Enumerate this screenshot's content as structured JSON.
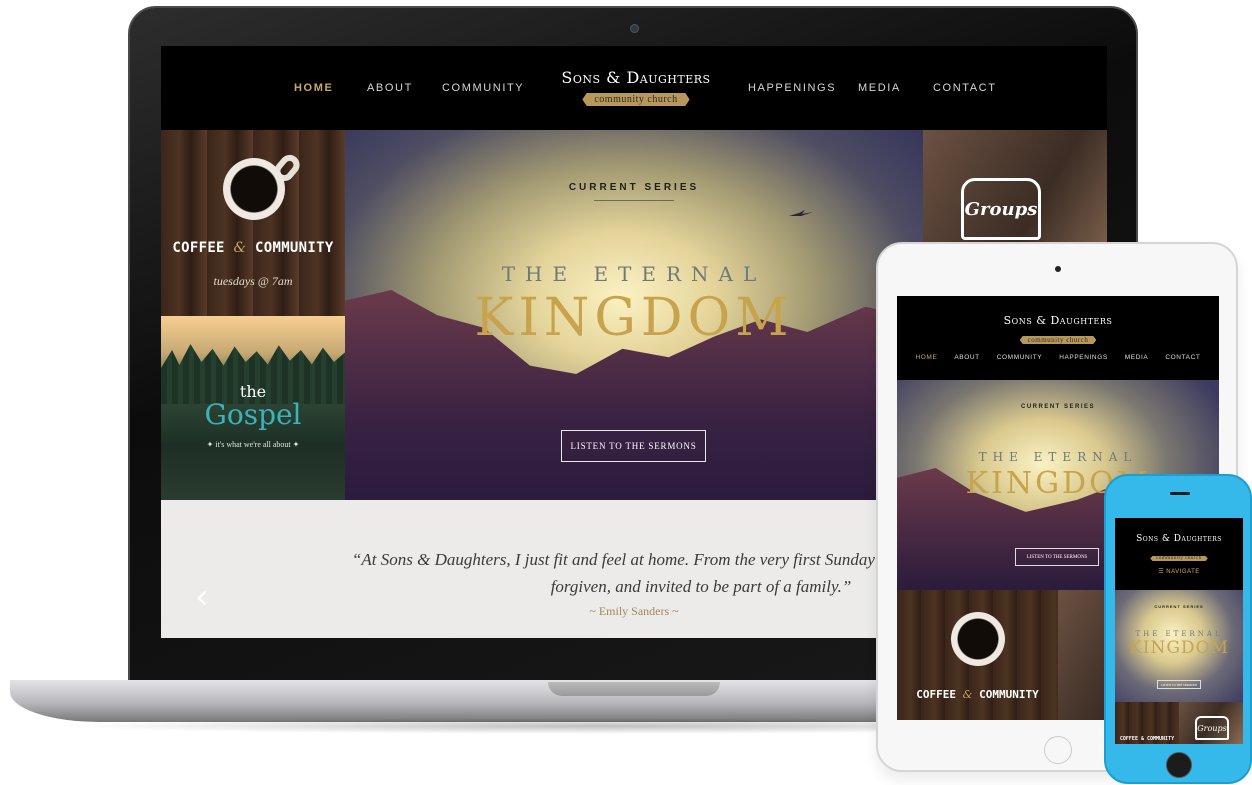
{
  "site": {
    "logo_title": "Sons & Daughters",
    "logo_subtitle": "community church"
  },
  "nav": {
    "items": [
      {
        "label": "HOME",
        "active": true
      },
      {
        "label": "ABOUT",
        "active": false
      },
      {
        "label": "COMMUNITY",
        "active": false
      },
      {
        "label": "HAPPENINGS",
        "active": false
      },
      {
        "label": "MEDIA",
        "active": false
      },
      {
        "label": "CONTACT",
        "active": false
      }
    ],
    "mobile_label": "NAVIGATE"
  },
  "coffee": {
    "title_left": "COFFEE",
    "amp": "&",
    "title_right": "COMMUNITY",
    "schedule": "tuesdays @ 7am"
  },
  "gospel": {
    "the": "the",
    "word": "Gospel",
    "tagline": "✦ it's what we're all about ✦"
  },
  "hero": {
    "series_label": "CURRENT SERIES",
    "title_small": "THE ETERNAL",
    "title_big": "KINGDOM",
    "button_label": "LISTEN TO THE SERMONS"
  },
  "groups": {
    "label": "Groups"
  },
  "testimonial": {
    "quote": "“At Sons & Daughters, I just fit and feel at home. From the very first Sunday I visited, I felt welcomed, forgiven, and invited to be part of a family.”",
    "author": "~ Emily Sanders ~"
  },
  "colors": {
    "accent_gold": "#c9a86a",
    "gospel_teal": "#3ab3bd",
    "phone_body": "#34b9ea"
  },
  "icons": {
    "prev": "chevron-left-icon",
    "menu": "hamburger-icon"
  }
}
